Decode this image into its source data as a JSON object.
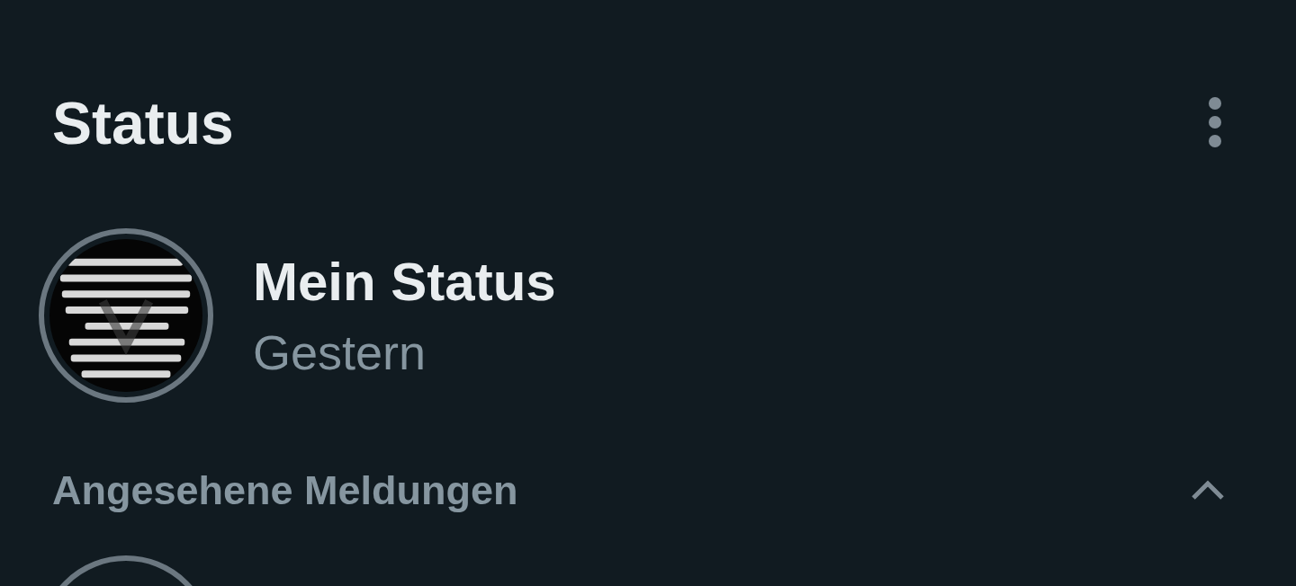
{
  "header": {
    "title": "Status"
  },
  "my_status": {
    "name": "Mein Status",
    "time": "Gestern"
  },
  "viewed_section": {
    "title": "Angesehene Meldungen",
    "expanded": true
  }
}
